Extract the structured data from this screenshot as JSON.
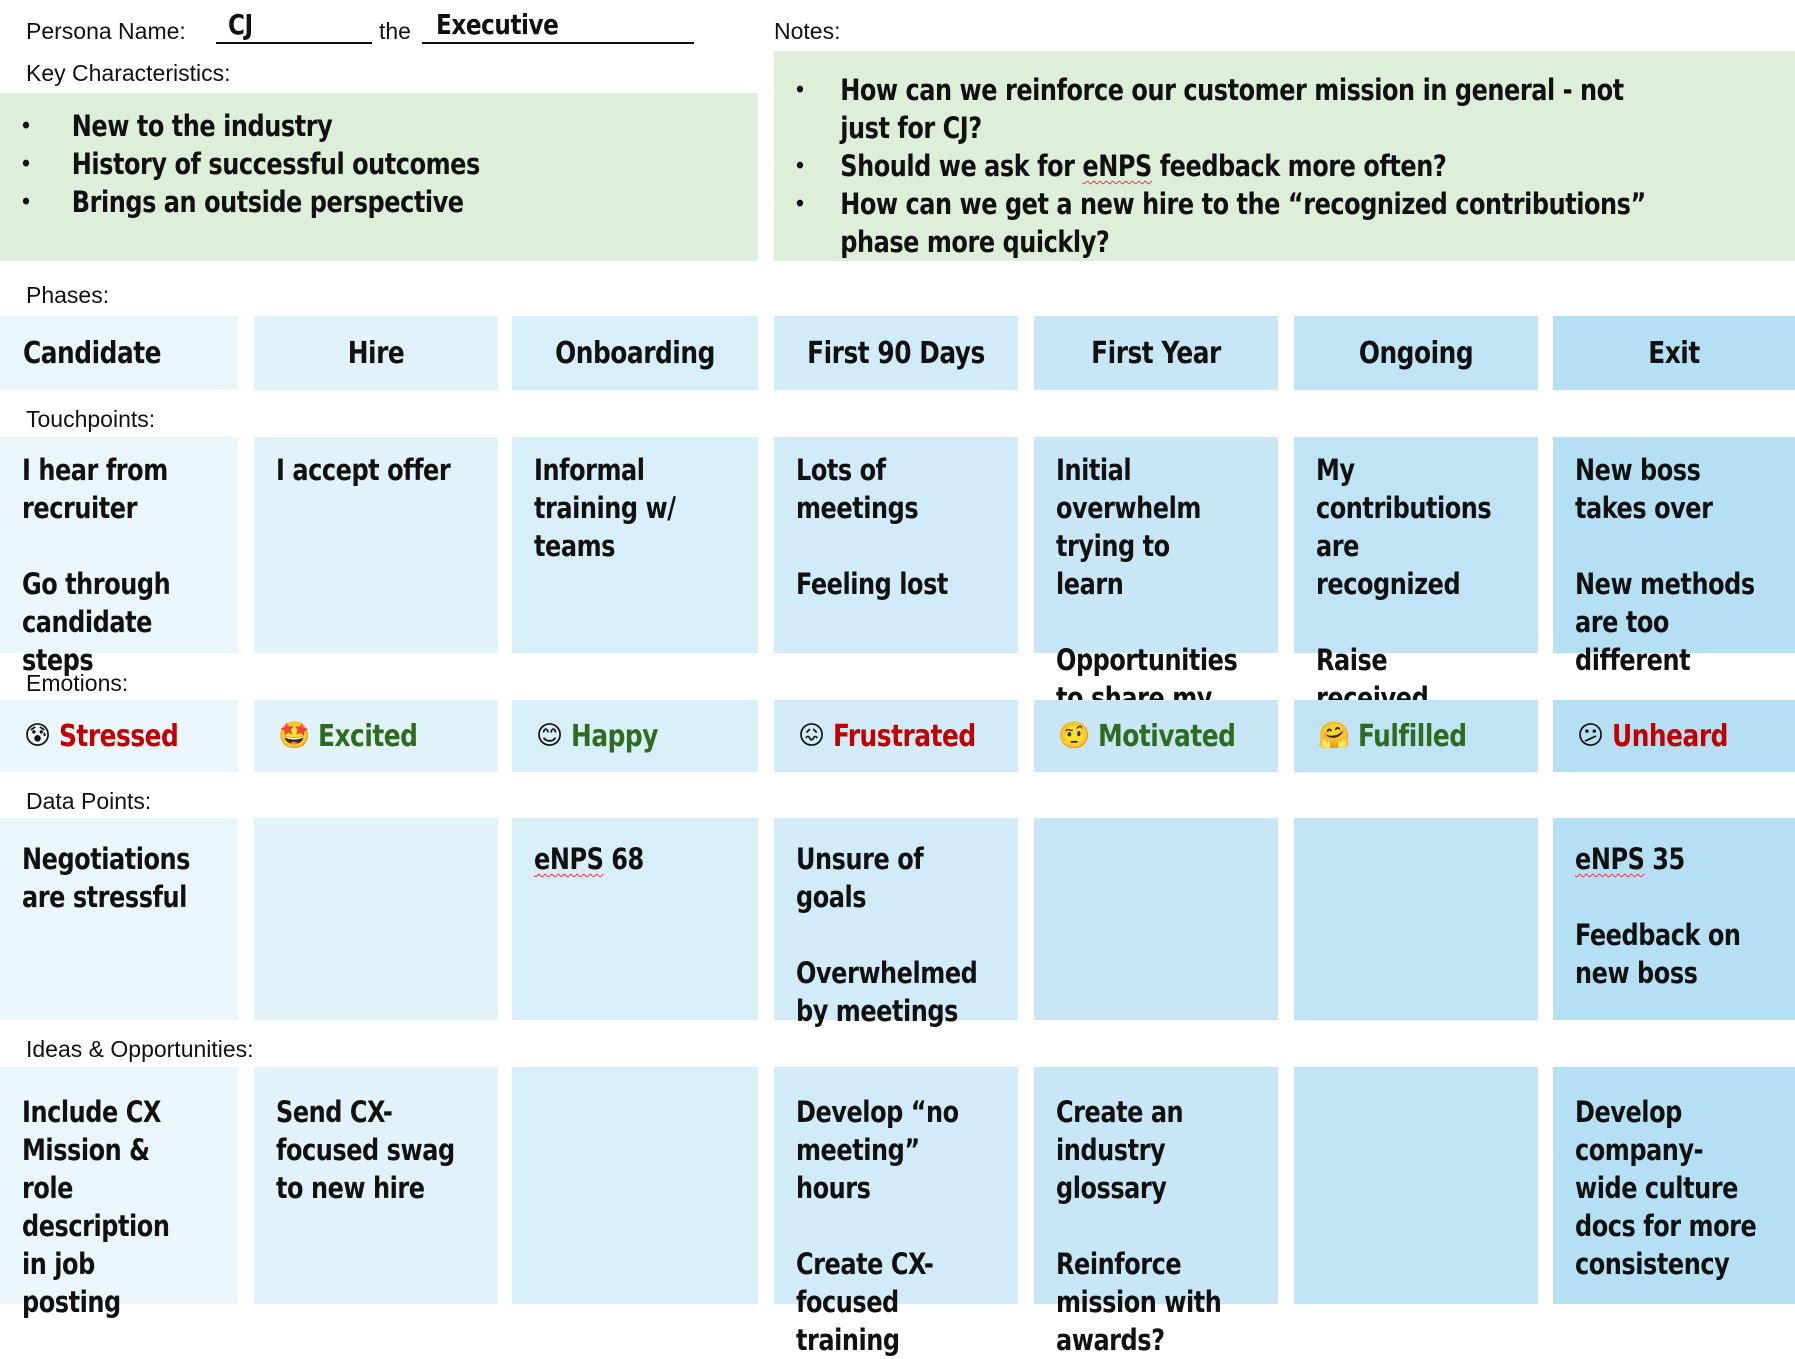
{
  "persona": {
    "name_label": "Persona Name:",
    "name_value": "CJ",
    "the_label": "the",
    "role_value": "Executive"
  },
  "key_characteristics": {
    "label": "Key Characteristics:",
    "items": [
      "New to the industry",
      "History of successful outcomes",
      "Brings an outside perspective"
    ]
  },
  "notes": {
    "label": "Notes:",
    "items": [
      "How can we reinforce our customer mission in general - not just for CJ?",
      "Should we ask for eNPS feedback more often?",
      "How can we get a new hire to the “recognized contributions” phase more quickly?"
    ]
  },
  "section_labels": {
    "phases": "Phases:",
    "touchpoints": "Touchpoints:",
    "emotions": "Emotions:",
    "data_points": "Data Points:",
    "ideas": "Ideas & Opportunities:"
  },
  "phases": [
    "Candidate",
    "Hire",
    "Onboarding",
    "First 90 Days",
    "First Year",
    "Ongoing",
    "Exit"
  ],
  "touchpoints": [
    [
      "I hear from recruiter",
      "Go through candidate steps"
    ],
    [
      "I accept offer"
    ],
    [
      "Informal training w/ teams"
    ],
    [
      "Lots of meetings",
      "Feeling lost"
    ],
    [
      "Initial overwhelm trying to learn",
      "Opportunities to share my ideas"
    ],
    [
      "My contributions are recognized",
      "Raise received"
    ],
    [
      "New boss takes over",
      "New methods are too different"
    ]
  ],
  "emotions": [
    {
      "icon": "anxious-sweat-face-icon",
      "glyph": "😰",
      "label": "Stressed",
      "tone": "negative",
      "color": "#c00000"
    },
    {
      "icon": "star-struck-face-icon",
      "glyph": "🤩",
      "label": "Excited",
      "tone": "positive",
      "color": "#2e6b1f"
    },
    {
      "icon": "smiling-face-icon",
      "glyph": "😊",
      "label": "Happy",
      "tone": "positive",
      "color": "#2e6b1f"
    },
    {
      "icon": "confounded-face-icon",
      "glyph": "😖",
      "label": "Frustrated",
      "tone": "negative",
      "color": "#c00000"
    },
    {
      "icon": "raised-eyebrow-face-icon",
      "glyph": "🤨",
      "label": "Motivated",
      "tone": "positive",
      "color": "#2e6b1f"
    },
    {
      "icon": "hugging-face-icon",
      "glyph": "🤗",
      "label": "Fulfilled",
      "tone": "positive",
      "color": "#2e6b1f"
    },
    {
      "icon": "confused-face-icon",
      "glyph": "😕",
      "label": "Unheard",
      "tone": "negative",
      "color": "#c00000"
    }
  ],
  "data_points": [
    [
      "Negotiations are stressful"
    ],
    [],
    [
      "eNPS 68"
    ],
    [
      "Unsure of goals",
      "Overwhelmed by meetings"
    ],
    [],
    [],
    [
      "eNPS 35",
      "Feedback on new boss"
    ]
  ],
  "ideas": [
    [
      "Include CX Mission & role description in job posting"
    ],
    [
      "Send CX-focused swag to new hire"
    ],
    [],
    [
      "Develop “no meeting” hours",
      "Create CX-focused training"
    ],
    [
      "Create an industry glossary",
      "Reinforce mission with awards?"
    ],
    [],
    [
      "Develop company-wide culture docs for more consistency"
    ]
  ],
  "colors": {
    "notes_bg": "#deefd9",
    "negative_emotion": "#c00000",
    "positive_emotion": "#2e6b1f",
    "column_bgs": [
      "#eaf6fc",
      "#e1f2fa",
      "#d8eef9",
      "#d2ebf8",
      "#c8e6f6",
      "#c0e3f5",
      "#b5e0f4"
    ]
  }
}
